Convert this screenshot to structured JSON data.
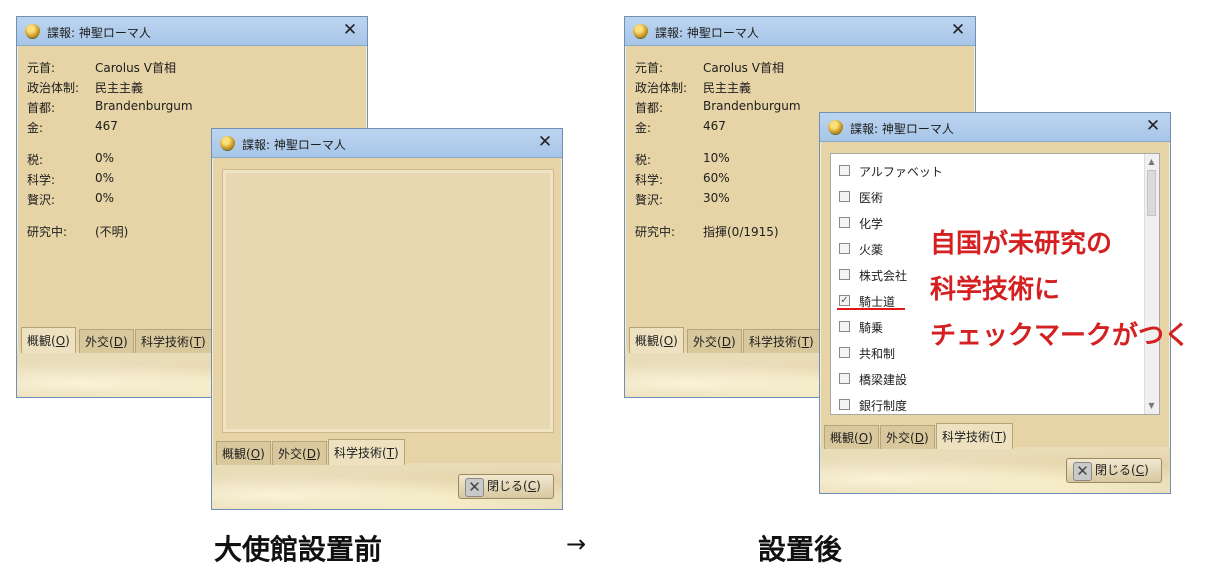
{
  "window_title": "諜報: 神聖ローマ人",
  "close_glyph": "✕",
  "overview": {
    "labels": {
      "leader": "元首:",
      "government": "政治体制:",
      "capital": "首都:",
      "gold": "金:",
      "tax": "税:",
      "science": "科学:",
      "luxury": "贅沢:",
      "researching": "研究中:"
    },
    "before": {
      "leader": "Carolus V首相",
      "government": "民主主義",
      "capital": "Brandenburgum",
      "gold": "467",
      "tax": "0%",
      "science": "0%",
      "luxury": "0%",
      "researching": "(不明)"
    },
    "after": {
      "leader": "Carolus V首相",
      "government": "民主主義",
      "capital": "Brandenburgum",
      "gold": "467",
      "tax": "10%",
      "science": "60%",
      "luxury": "30%",
      "researching": "指揮(0/1915)"
    }
  },
  "tabs": {
    "overview": "概観(",
    "overview_key": "O",
    "diplomacy": "外交(",
    "diplomacy_key": "D",
    "tech": "科学技術(",
    "tech_key": "T",
    "paren_close": ")"
  },
  "close_button": {
    "label": "閉じる(",
    "key": "C",
    "paren_close": ")",
    "icon": "✕"
  },
  "tech_list": [
    {
      "name": "アルファベット",
      "checked": false
    },
    {
      "name": "医術",
      "checked": false
    },
    {
      "name": "化学",
      "checked": false
    },
    {
      "name": "火薬",
      "checked": false
    },
    {
      "name": "株式会社",
      "checked": false
    },
    {
      "name": "騎士道",
      "checked": true
    },
    {
      "name": "騎乗",
      "checked": false
    },
    {
      "name": "共和制",
      "checked": false
    },
    {
      "name": "橋梁建設",
      "checked": false
    },
    {
      "name": "銀行制度",
      "checked": false
    }
  ],
  "check_glyph": "✓",
  "annotation": [
    "自国が未研究の",
    "科学技術に",
    "チェックマークがつく"
  ],
  "captions": {
    "before": "大使館設置前",
    "arrow": "→",
    "after": "設置後"
  },
  "colors": {
    "annotation": "#d42020",
    "titlebar": "#a8c6e8",
    "window_bg": "#e6d3a6"
  }
}
